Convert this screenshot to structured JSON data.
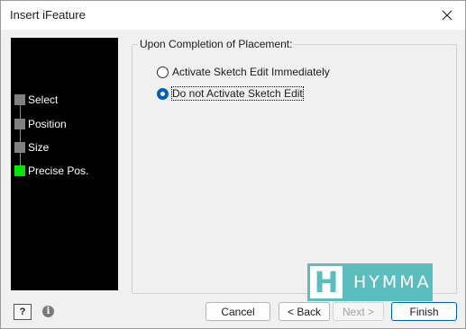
{
  "window": {
    "title": "Insert iFeature",
    "close_icon": "close-icon"
  },
  "steps": [
    {
      "label": "Select",
      "active": false
    },
    {
      "label": "Position",
      "active": false
    },
    {
      "label": "Size",
      "active": false
    },
    {
      "label": "Precise Pos.",
      "active": true
    }
  ],
  "placement": {
    "group_label": "Upon Completion of Placement:",
    "options": [
      {
        "label": "Activate Sketch Edit Immediately",
        "checked": false
      },
      {
        "label": "Do not Activate Sketch Edit",
        "checked": true
      }
    ]
  },
  "watermark": {
    "letter": "H",
    "text": "HYMMA"
  },
  "footer": {
    "help_icon": "help-icon",
    "help_glyph": "?",
    "info_icon": "info-icon",
    "info_glyph": "i",
    "cancel_label": "Cancel",
    "back_label": "< Back",
    "next_label": "Next >",
    "finish_label": "Finish"
  },
  "colors": {
    "active_step": "#00e600",
    "inactive_step": "#808080",
    "accent": "#005fb8",
    "watermark": "#5bbdbd"
  }
}
